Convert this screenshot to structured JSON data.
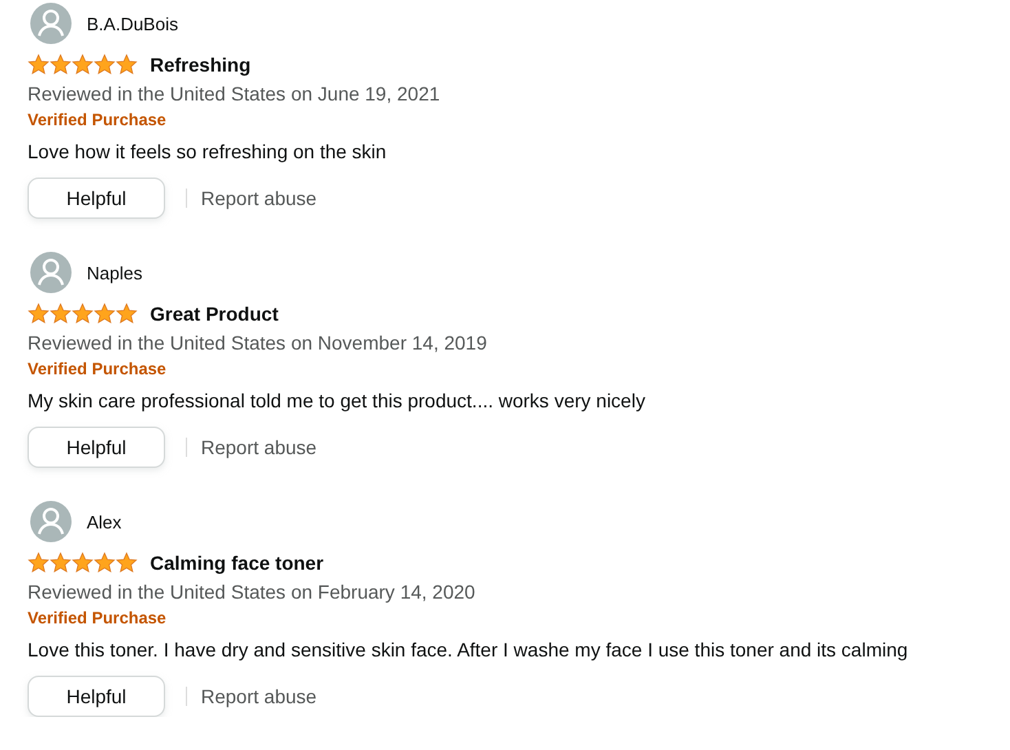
{
  "reviews": [
    {
      "name": "B.A.DuBois",
      "stars": 5,
      "title": "Refreshing",
      "date": "Reviewed in the United States on June 19, 2021",
      "badge": "Verified Purchase",
      "body": "Love how it feels so refreshing on the skin",
      "helpful": "Helpful",
      "report": "Report abuse"
    },
    {
      "name": "Naples",
      "stars": 5,
      "title": "Great Product",
      "date": "Reviewed in the United States on November 14, 2019",
      "badge": "Verified Purchase",
      "body": "My skin care professional told me to get this product.... works very nicely",
      "helpful": "Helpful",
      "report": "Report abuse"
    },
    {
      "name": "Alex",
      "stars": 5,
      "title": "Calming face toner",
      "date": "Reviewed in the United States on February 14, 2020",
      "badge": "Verified Purchase",
      "body": "Love this toner. I have dry and sensitive skin face. After I washe my face I use this toner and its calming",
      "helpful": "Helpful",
      "report": "Report abuse"
    }
  ]
}
